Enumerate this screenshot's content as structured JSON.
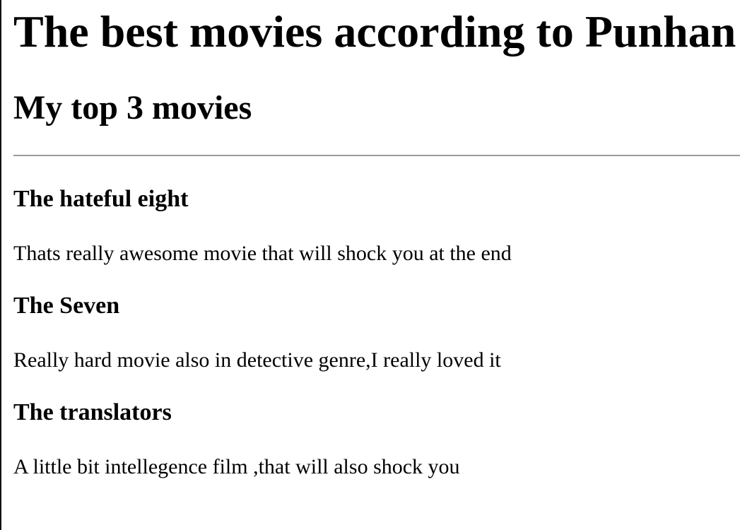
{
  "page": {
    "title": "The best movies according to Punhan",
    "section_title": "My top 3 movies"
  },
  "movies": [
    {
      "title": "The hateful eight",
      "description": "Thats really awesome movie that will shock you at the end"
    },
    {
      "title": "The Seven",
      "description": "Really hard movie also in detective genre,I really loved it"
    },
    {
      "title": "The translators",
      "description": "A little bit intellegence film ,that will also shock you"
    }
  ]
}
